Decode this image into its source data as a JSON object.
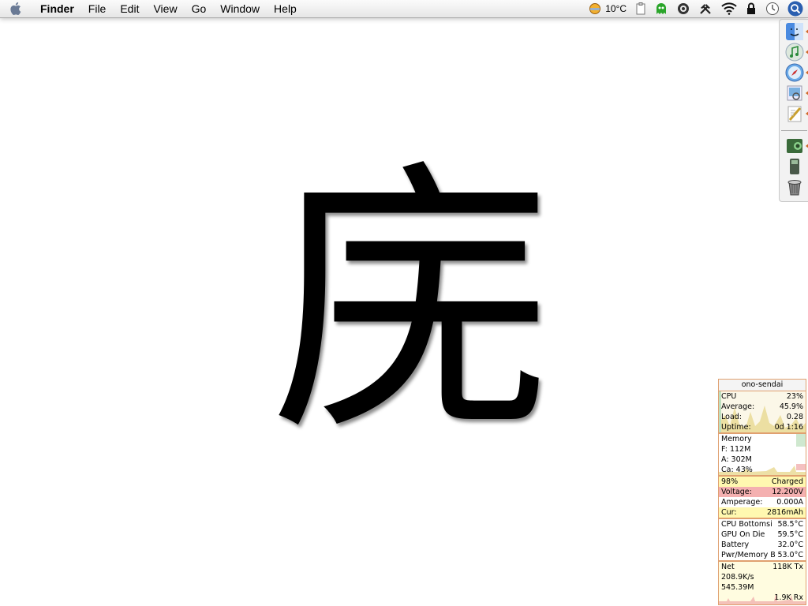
{
  "menubar": {
    "apple_icon": "apple-icon",
    "app_name": "Finder",
    "menus": [
      "File",
      "Edit",
      "View",
      "Go",
      "Window",
      "Help"
    ],
    "status": {
      "weather_temp": "10°C",
      "icons": [
        "weather-icon",
        "clipboard-icon",
        "ghost-icon",
        "camera-icon",
        "tools-icon",
        "wifi-icon",
        "lock-icon",
        "clock-icon",
        "spotlight-icon"
      ]
    }
  },
  "desktop": {
    "character": "庑"
  },
  "dock": {
    "items": [
      "finder-icon",
      "itunes-icon",
      "safari-icon",
      "preview-icon",
      "textedit-icon",
      "folder-icon",
      "stuff-icon",
      "trash-icon"
    ],
    "running": [
      true,
      true,
      true,
      true,
      true,
      true,
      false,
      false
    ]
  },
  "monitor": {
    "title": "ono-sendai",
    "cpu": {
      "label": "CPU",
      "value": "23%",
      "average_label": "Average:",
      "average": "45.9%",
      "load_label": "Load:",
      "load": "0.28",
      "uptime_label": "Uptime:",
      "uptime": "0d 1:16"
    },
    "memory": {
      "label": "Memory",
      "free": "F: 112M",
      "active": "A: 302M",
      "cache": "Ca: 43%"
    },
    "battery": {
      "percent": "98%",
      "status": "Charged",
      "voltage_label": "Voltage:",
      "voltage": "12.200V",
      "amperage_label": "Amperage:",
      "amperage": "0.000A",
      "current_label": "Cur:",
      "current": "2816mAh"
    },
    "temps": [
      {
        "label": "CPU Bottomsi",
        "value": "58.5°C"
      },
      {
        "label": "GPU On Die",
        "value": "59.5°C"
      },
      {
        "label": "Battery",
        "value": "32.0°C"
      },
      {
        "label": "Pwr/Memory B",
        "value": "53.0°C"
      }
    ],
    "net": {
      "label": "Net",
      "tx": "118K Tx",
      "rate": "208.9K/s",
      "total": "545.39M",
      "rx": "1.9K Rx"
    },
    "colors": {
      "border": "#e0a070",
      "cpu": "#e8d890",
      "battery_red": "#f4b0b0",
      "net": "#fff8b0"
    }
  }
}
